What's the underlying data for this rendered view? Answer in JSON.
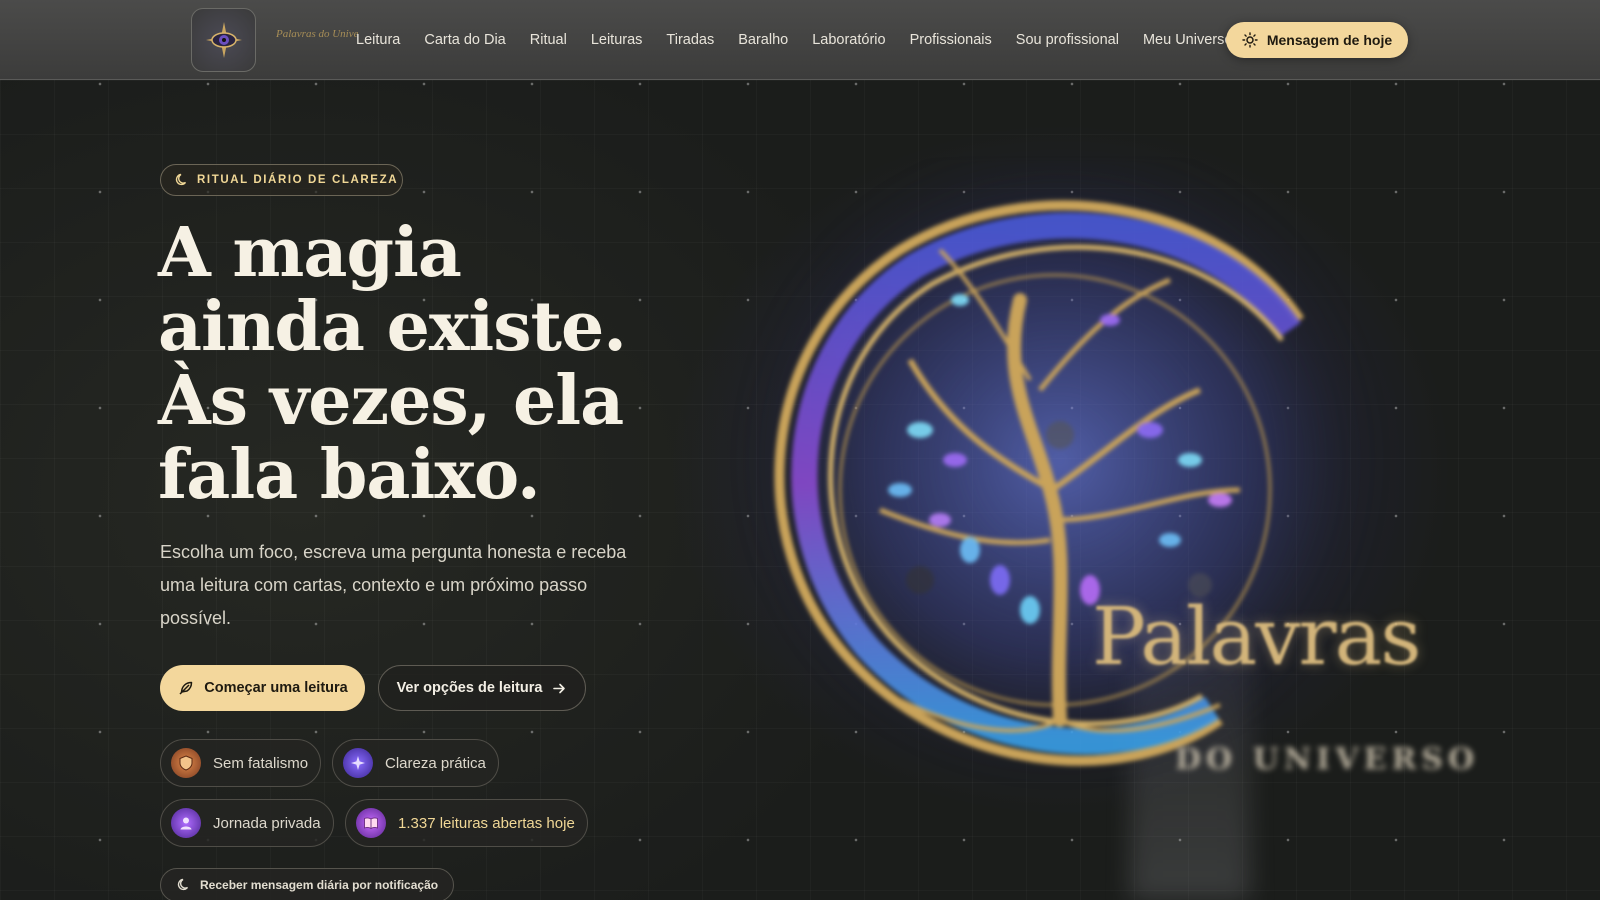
{
  "nav": {
    "logo_wordmark": "Palavras do Universo",
    "links": [
      "Leitura",
      "Carta do Dia",
      "Ritual",
      "Leituras",
      "Tiradas",
      "Baralho",
      "Laboratório",
      "Profissionais",
      "Sou profissional",
      "Meu Universo"
    ],
    "cta_label": "Mensagem de hoje",
    "cta_icon": "sun-icon"
  },
  "hero": {
    "eyebrow": "RITUAL DIÁRIO DE CLAREZA",
    "eyebrow_icon": "moon-icon",
    "headline": [
      "A magia",
      "ainda existe.",
      "Às vezes, ela",
      "fala baixo."
    ],
    "subtitle": "Escolha um foco, escreva uma pergunta honesta e receba uma leitura com cartas, contexto e um próximo passo possível.",
    "primary_button": "Começar uma leitura",
    "primary_icon": "feather-icon",
    "secondary_button": "Ver opções de leitura",
    "secondary_icon": "arrow-right-icon",
    "chips": [
      {
        "label": "Sem fatalismo",
        "icon": "shield-icon"
      },
      {
        "label": "Clareza prática",
        "icon": "sparkle-icon"
      },
      {
        "label": "Jornada privada",
        "icon": "person-icon"
      },
      {
        "label": "1.337 leituras abertas hoje",
        "icon": "book-icon"
      }
    ],
    "notify_label": "Receber mensagem diária por notificação",
    "notify_icon": "moon-icon"
  },
  "art": {
    "title": "Palavras",
    "subtitle": "DO UNIVERSO"
  },
  "colors": {
    "accent": "#f3d79c",
    "background": "#1c1e1c",
    "gold": "#d2b47a",
    "nav": "#434342"
  }
}
